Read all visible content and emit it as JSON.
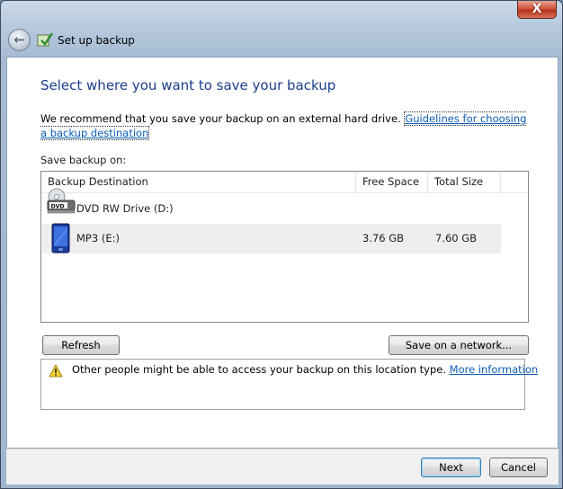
{
  "window": {
    "title": "Set up backup",
    "close_glyph": "X",
    "back_glyph": "←"
  },
  "page": {
    "heading": "Select where you want to save your backup",
    "recommend_text": "We recommend that you save your backup on an external hard drive.",
    "guidelines_link": "Guidelines for choosing a backup destination",
    "save_on_label": "Save backup on:"
  },
  "list": {
    "columns": [
      "Backup Destination",
      "Free Space",
      "Total Size"
    ],
    "rows": [
      {
        "name": "DVD RW Drive (D:)",
        "free": "",
        "total": "",
        "icon": "dvd-drive-icon",
        "selected": false
      },
      {
        "name": "MP3 (E:)",
        "free": "3.76 GB",
        "total": "7.60 GB",
        "icon": "mp3-player-icon",
        "selected": true
      }
    ]
  },
  "buttons": {
    "refresh": "Refresh",
    "save_network": "Save on a network...",
    "next": "Next",
    "cancel": "Cancel"
  },
  "warning": {
    "text": "Other people might be able to access your backup on this location type.",
    "link": "More information",
    "icon": "warning-icon"
  },
  "colors": {
    "heading": "#1a3e8c",
    "link": "#0b5cb6",
    "close_red": "#c0392b"
  }
}
